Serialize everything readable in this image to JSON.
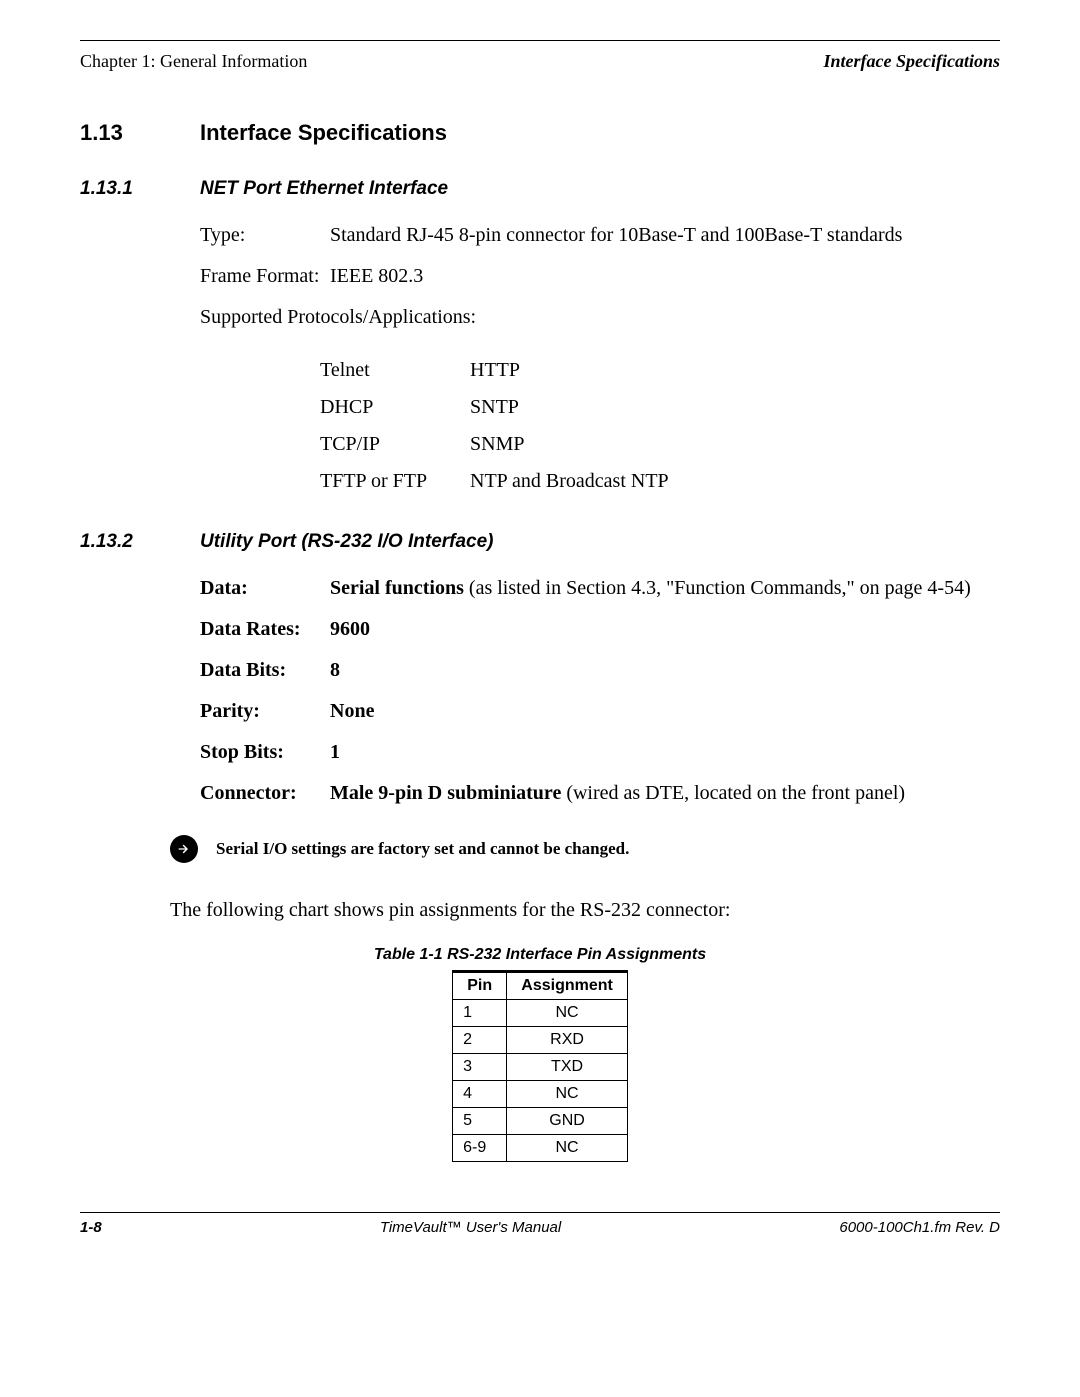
{
  "header": {
    "left": "Chapter 1: General Information",
    "right": "Interface Specifications"
  },
  "section": {
    "num": "1.13",
    "title": "Interface Specifications"
  },
  "sub1": {
    "num": "1.13.1",
    "title": "NET Port Ethernet Interface",
    "rows": {
      "type_label": "Type:",
      "type_value": "Standard RJ-45 8-pin connector for 10Base-T and 100Base-T standards",
      "frame_label": "Frame Format:",
      "frame_value": "IEEE 802.3",
      "proto_label": "Supported Protocols/Applications:"
    },
    "protocols": [
      {
        "c1": "Telnet",
        "c2": "HTTP"
      },
      {
        "c1": "DHCP",
        "c2": "SNTP"
      },
      {
        "c1": "TCP/IP",
        "c2": "SNMP"
      },
      {
        "c1": "TFTP or FTP",
        "c2": "NTP and Broadcast NTP"
      }
    ]
  },
  "sub2": {
    "num": "1.13.2",
    "title": "Utility Port (RS-232 I/O Interface)",
    "rows": [
      {
        "label": "Data:",
        "boldpart": "Serial functions",
        "rest": " (as listed in Section 4.3, \"Function Commands,\" on page 4-54)"
      },
      {
        "label": "Data Rates:",
        "boldpart": "9600",
        "rest": ""
      },
      {
        "label": "Data Bits:",
        "boldpart": "8",
        "rest": ""
      },
      {
        "label": "Parity:",
        "boldpart": "None",
        "rest": ""
      },
      {
        "label": "Stop Bits:",
        "boldpart": "1",
        "rest": ""
      },
      {
        "label": "Connector:",
        "boldpart": "Male 9-pin D subminiature",
        "rest": " (wired as DTE, located on the front panel)"
      }
    ]
  },
  "note": "Serial I/O settings are factory set and cannot be changed.",
  "followup": "The following chart shows pin assignments for the RS-232 connector:",
  "table": {
    "caption": "Table 1-1  RS-232 Interface Pin Assignments",
    "headers": {
      "pin": "Pin",
      "assign": "Assignment"
    },
    "rows": [
      {
        "pin": "1",
        "assign": "NC"
      },
      {
        "pin": "2",
        "assign": "RXD"
      },
      {
        "pin": "3",
        "assign": "TXD"
      },
      {
        "pin": "4",
        "assign": "NC"
      },
      {
        "pin": "5",
        "assign": "GND"
      },
      {
        "pin": "6-9",
        "assign": "NC"
      }
    ]
  },
  "footer": {
    "left": "1-8",
    "center": "TimeVault™ User's Manual",
    "right": "6000-100Ch1.fm  Rev. D"
  }
}
